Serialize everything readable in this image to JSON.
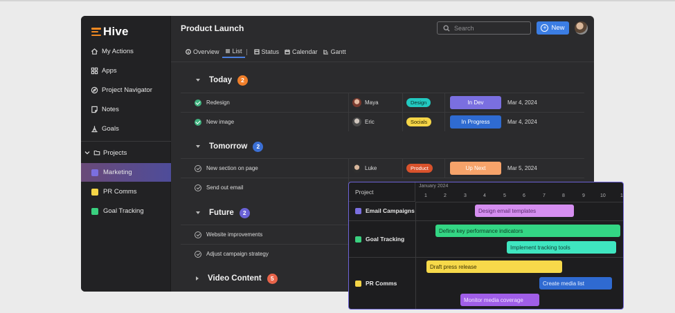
{
  "app": {
    "logo_text": "Hive",
    "brand_color": "#f28a22"
  },
  "sidebar": {
    "nav": [
      {
        "label": "My Actions",
        "icon": "home-icon"
      },
      {
        "label": "Apps",
        "icon": "apps-grid-icon"
      },
      {
        "label": "Project Navigator",
        "icon": "compass-icon"
      },
      {
        "label": "Notes",
        "icon": "note-icon"
      },
      {
        "label": "Goals",
        "icon": "goals-icon"
      }
    ],
    "projects_label": "Projects",
    "projects": [
      {
        "label": "Marketing",
        "color": "#7b6fe0",
        "active": true
      },
      {
        "label": "PR Comms",
        "color": "#f5d547",
        "active": false
      },
      {
        "label": "Goal Tracking",
        "color": "#3ad07f",
        "active": false
      }
    ]
  },
  "header": {
    "title": "Product Launch",
    "search_placeholder": "Search",
    "new_label": "New"
  },
  "tabs": [
    {
      "label": "Overview",
      "icon": "info-icon"
    },
    {
      "label": "List",
      "icon": "list-icon",
      "active": true
    },
    {
      "label": "Status",
      "icon": "status-icon"
    },
    {
      "label": "Calendar",
      "icon": "calendar-icon"
    },
    {
      "label": "Gantt",
      "icon": "gantt-icon"
    }
  ],
  "groups": [
    {
      "name": "Today",
      "count": "2",
      "badge_color": "#f07f2a"
    },
    {
      "name": "Tomorrow",
      "count": "2",
      "badge_color": "#3b6fd4"
    },
    {
      "name": "Future",
      "count": "2",
      "badge_color": "#6a62d6"
    },
    {
      "name": "Video Content",
      "count": "5",
      "badge_color": "#e8644a"
    }
  ],
  "tasks": [
    {
      "name": "Redesign",
      "done": true,
      "assignee": "Maya",
      "tag": "Design",
      "tag_bg": "#22c9c0",
      "tag_fg": "#0d2b2a",
      "status": "In Dev",
      "status_bg": "#7a6fe0",
      "date": "Mar 4, 2024"
    },
    {
      "name": "New image",
      "done": true,
      "assignee": "Eric",
      "tag": "Socials",
      "tag_bg": "#f5d547",
      "tag_fg": "#2b2400",
      "status": "In Progress",
      "status_bg": "#2f6bd1",
      "date": "Mar 4, 2024"
    },
    {
      "name": "New section on page",
      "done": false,
      "assignee": "Luke",
      "tag": "Product",
      "tag_bg": "#d9522c",
      "tag_fg": "#ffffff",
      "status": "Up Next",
      "status_bg": "#f6a36a",
      "date": "Mar 5, 2024"
    },
    {
      "name": "Send out email",
      "done": false
    },
    {
      "name": "Website improvements",
      "done": false
    },
    {
      "name": "Adjust campaign strategy",
      "done": false
    }
  ],
  "gantt": {
    "column_label": "Project",
    "month": "January 2024",
    "days": [
      "1",
      "2",
      "3",
      "4",
      "5",
      "6",
      "7",
      "8",
      "9",
      "10",
      "1"
    ],
    "projects": [
      {
        "label": "Email Campaigns",
        "color": "#7b6fe0"
      },
      {
        "label": "Goal Tracking",
        "color": "#3ad07f"
      },
      {
        "label": "PR Comms",
        "color": "#f5d547"
      }
    ],
    "bars": [
      {
        "label": "Design email templates",
        "bg": "#d58ef0",
        "fg": "#5a2a6e"
      },
      {
        "label": "Define key performance indicators",
        "bg": "#33d684",
        "fg": "#0e3b24"
      },
      {
        "label": "Implement tracking tools",
        "bg": "#3fe6c0",
        "fg": "#0f3d34"
      },
      {
        "label": "Draft press release",
        "bg": "#f7d94a",
        "fg": "#3a3000"
      },
      {
        "label": "Create media list",
        "bg": "#2f6ad1",
        "fg": "#e8f0ff"
      },
      {
        "label": "Monitor media coverage",
        "bg": "#a05ee8",
        "fg": "#f3e6ff"
      }
    ]
  }
}
